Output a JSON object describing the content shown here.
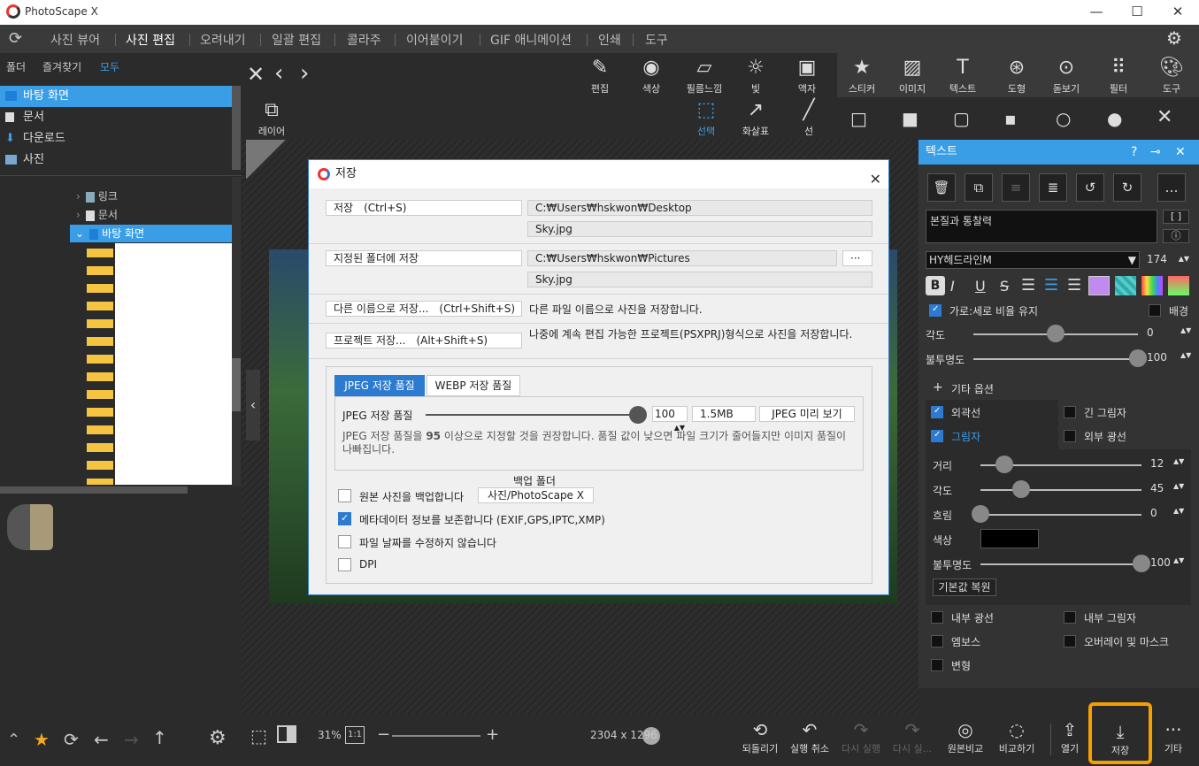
{
  "window": {
    "title": "PhotoScape X",
    "minimize": "—",
    "maximize": "☐",
    "close": "✕"
  },
  "mainmenu": {
    "items": [
      "사진 뷰어",
      "사진 편집",
      "오려내기",
      "일괄 편집",
      "콜라주",
      "이어붙이기",
      "GIF 애니메이션",
      "인쇄",
      "도구"
    ],
    "active": "사진 편집"
  },
  "left": {
    "tabs": [
      "폴더",
      "즐겨찾기",
      "모두"
    ],
    "quick": [
      "바탕 화면",
      "문서",
      "다운로드",
      "사진"
    ],
    "tree": [
      "링크",
      "문서",
      "바탕 화면"
    ]
  },
  "toolbar": {
    "main": [
      "편집",
      "색상",
      "필름느낌",
      "빛",
      "액자",
      "스티커",
      "이미지",
      "텍스트",
      "도형",
      "돋보기",
      "필터",
      "도구"
    ],
    "layer": "레이어",
    "select": "선택",
    "arrow": "화살표",
    "line": "선"
  },
  "dialog": {
    "title": "저장",
    "save": "저장　(Ctrl+S)",
    "save_path": "C:₩Users₩hskwon₩Desktop",
    "save_file": "Sky.jpg",
    "save_folder": "지정된 폴더에 저장",
    "folder_path": "C:₩Users₩hskwon₩Pictures",
    "folder_browse": "···",
    "folder_file": "Sky.jpg",
    "save_as": "다른 이름으로 저장...　(Ctrl+Shift+S)",
    "save_as_desc": "다른 파일 이름으로 사진을 저장합니다.",
    "project": "프로젝트 저장...　(Alt+Shift+S)",
    "project_desc": "나중에 계속 편집 가능한 프로젝트(PSXPRJ)형식으로 사진을 저장합니다.",
    "tab_jpeg": "JPEG 저장 품질",
    "tab_webp": "WEBP 저장 품질",
    "quality_label": "JPEG 저장 품질",
    "quality_value": "100",
    "quality_fraction": 1.0,
    "file_size": "1.5MB",
    "preview": "JPEG 미리 보기",
    "hint_pre": "JPEG 저장 품질을 ",
    "hint_num": "95",
    "hint_post": " 이상으로 지정할 것을 권장합니다. 품질 값이 낮으면 파일 크기가 줄어들지만 이미지 품질이 나빠집니다.",
    "backup_title": "백업 폴더",
    "backup": "원본 사진을 백업합니다",
    "backup_path": "사진/PhotoScape X",
    "metadata": "메타데이터 정보를 보존합니다 (EXIF,GPS,IPTC,XMP)",
    "keep_date": "파일 날짜를 수정하지 않습니다",
    "dpi": "DPI"
  },
  "panel": {
    "title": "텍스트",
    "text": "본질과 통찰력",
    "font": "HY헤드라인M",
    "size": "174",
    "keep_ratio": "가로:세로 비율 유지",
    "background": "배경",
    "angle_label": "각도",
    "angle": "0",
    "angle_fraction": 0.5,
    "opacity_label": "불투명도",
    "opacity": "100",
    "opacity_fraction": 1.0,
    "more": "기타 옵션",
    "outline": "외곽선",
    "long_shadow": "긴 그림자",
    "shadow": "그림자",
    "outer_glow": "외부 광선",
    "dist_label": "거리",
    "dist": "12",
    "dist_fraction": 0.15,
    "sh_angle_label": "각도",
    "sh_angle": "45",
    "sh_angle_fraction": 0.25,
    "blur_label": "흐림",
    "blur": "0",
    "blur_fraction": 0.0,
    "color_label": "색상",
    "sh_opacity_label": "불투명도",
    "sh_opacity": "100",
    "sh_opacity_fraction": 1.0,
    "reset": "기본값 복원",
    "inner_glow": "내부 광선",
    "inner_shadow": "내부 그림자",
    "emboss": "엠보스",
    "overlay": "오버레이 및 마스크",
    "transform": "변형",
    "accent": "#3a9ee6"
  },
  "bottom": {
    "zoom": "31%",
    "zoom_11": "1:1",
    "zoom_fraction": 0.2,
    "dims": "2304 x 1296",
    "buttons": [
      "되돌리기",
      "실행 취소",
      "다시 실행",
      "다시 실...",
      "원본비교",
      "비교하기",
      "열기",
      "저장",
      "기타"
    ]
  }
}
